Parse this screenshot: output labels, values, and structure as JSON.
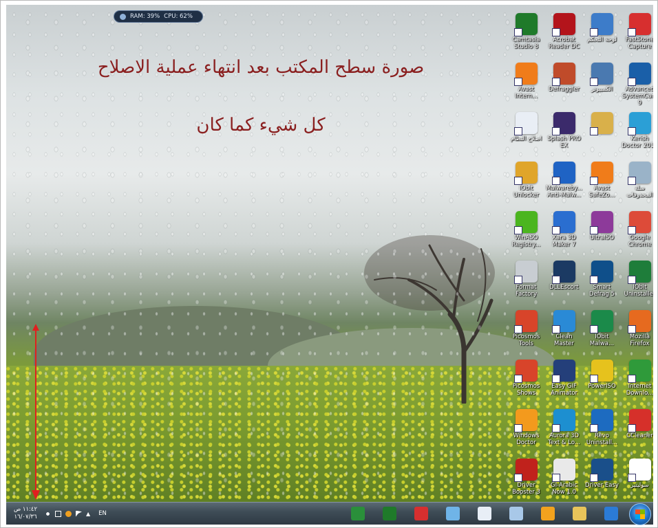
{
  "overlay": {
    "line1": "صورة سطح المكتب بعد انتهاء عملية الاصلاح",
    "line2": "كل شيء كما كان"
  },
  "gauge": {
    "ram": "RAM: 39%",
    "cpu": "CPU: 62%"
  },
  "desktop_icons": [
    {
      "label": "Camtasia Studio 8",
      "icon": "camtasia-icon",
      "color": "#1f7a2a"
    },
    {
      "label": "Acrobat Reader DC",
      "icon": "acrobat-icon",
      "color": "#b3141b"
    },
    {
      "label": "لوحة التحكم",
      "icon": "control-panel-icon",
      "color": "#3d7cc9"
    },
    {
      "label": "FastStone Capture",
      "icon": "faststone-icon",
      "color": "#d72f2f"
    },
    {
      "label": "Avast Intern...",
      "icon": "avast-icon",
      "color": "#f07c1a"
    },
    {
      "label": "Defraggler",
      "icon": "defraggler-icon",
      "color": "#c04b2a"
    },
    {
      "label": "الكمبيوتر",
      "icon": "computer-icon",
      "color": "#4a79b0"
    },
    {
      "label": "Advanced SystemCare 9",
      "icon": "systemcare-icon",
      "color": "#1a5fa8"
    },
    {
      "label": "اصلاح النظام",
      "icon": "document-icon",
      "color": "#e9eef5"
    },
    {
      "label": "Splash PRO EX",
      "icon": "splash-icon",
      "color": "#3b2a6b"
    },
    {
      "label": "",
      "icon": "user-folder-icon",
      "color": "#d9b04a"
    },
    {
      "label": "Kerish Doctor 2016",
      "icon": "kerish-icon",
      "color": "#2b9fd6"
    },
    {
      "label": "IObit Unlocker",
      "icon": "unlocker-icon",
      "color": "#e0a52a"
    },
    {
      "label": "Malwareby... Anti-Malw...",
      "icon": "malwarebytes-icon",
      "color": "#1f63c4"
    },
    {
      "label": "Avast SafeZo...",
      "icon": "safezone-icon",
      "color": "#f07c1a"
    },
    {
      "label": "سلة المحذوفات",
      "icon": "recycle-bin-icon",
      "color": "#9ab3c8"
    },
    {
      "label": "WinASO Registry...",
      "icon": "winaso-icon",
      "color": "#4bb51f"
    },
    {
      "label": "Xara 3D Maker 7",
      "icon": "xara-icon",
      "color": "#2a6ed0"
    },
    {
      "label": "UltraISO",
      "icon": "ultraiso-icon",
      "color": "#8d3a9a"
    },
    {
      "label": "Google Chrome",
      "icon": "chrome-icon",
      "color": "#dd4b39"
    },
    {
      "label": "Format Factory",
      "icon": "format-factory-icon",
      "color": "#c8cdd2"
    },
    {
      "label": "DLLEscort",
      "icon": "dllescort-icon",
      "color": "#1b3a63"
    },
    {
      "label": "Smart Defrag 5",
      "icon": "smart-defrag-icon",
      "color": "#0f4f8a"
    },
    {
      "label": "IObit Uninstaller",
      "icon": "iobit-uninstaller-icon",
      "color": "#1e7d3a"
    },
    {
      "label": "Picosmos Tools",
      "icon": "picosmos-tools-icon",
      "color": "#d8442a"
    },
    {
      "label": "Clean Master",
      "icon": "clean-master-icon",
      "color": "#2a8ad6"
    },
    {
      "label": "IObit Malwa...",
      "icon": "iobit-malware-icon",
      "color": "#1b8a4a"
    },
    {
      "label": "Mozilla Firefox",
      "icon": "firefox-icon",
      "color": "#e66a1f"
    },
    {
      "label": "Picosmos Shows",
      "icon": "picosmos-shows-icon",
      "color": "#d8442a"
    },
    {
      "label": "Easy GIF Animator",
      "icon": "gif-animator-icon",
      "color": "#243f7a"
    },
    {
      "label": "PowerISO",
      "icon": "poweriso-icon",
      "color": "#e6c21d"
    },
    {
      "label": "Internet Downlo...",
      "icon": "idm-icon",
      "color": "#2f9a3a"
    },
    {
      "label": "Windows Doctor",
      "icon": "windows-doctor-icon",
      "color": "#f39a1d"
    },
    {
      "label": "Aurora 3D Text & Lo...",
      "icon": "aurora-icon",
      "color": "#1d8fd0"
    },
    {
      "label": "Revo Uninstall...",
      "icon": "revo-icon",
      "color": "#1d6bc0"
    },
    {
      "label": "CCleaner",
      "icon": "ccleaner-icon",
      "color": "#d6302a"
    },
    {
      "label": "Driver Booster 3",
      "icon": "driver-booster-icon",
      "color": "#c0221c"
    },
    {
      "label": "GI-Arabic Now 1.0",
      "icon": "gi-arabic-icon",
      "color": "#e9e9e9"
    },
    {
      "label": "Driver Easy",
      "icon": "driver-easy-icon",
      "color": "#1a4f8a"
    },
    {
      "label": "سوليتير",
      "icon": "solitaire-icon",
      "color": "#ffffff"
    }
  ],
  "taskbar": {
    "time": "١١:٤٢ ص",
    "date": "١٦/٠٧/٣٦",
    "lang": "EN",
    "pinned": [
      {
        "icon": "camtasia-recorder-icon",
        "color": "#2a8f3a"
      },
      {
        "icon": "camtasia-studio-icon",
        "color": "#1f7a2a"
      },
      {
        "icon": "faststone-taskbar-icon",
        "color": "#d72f2f"
      },
      {
        "icon": "paint-icon",
        "color": "#6fb4e8"
      },
      {
        "icon": "wordpad-icon",
        "color": "#e8eef6"
      },
      {
        "icon": "paint-net-icon",
        "color": "#a8c8e8"
      },
      {
        "icon": "media-player-icon",
        "color": "#f2a21e"
      },
      {
        "icon": "explorer-icon",
        "color": "#e8c45a"
      },
      {
        "icon": "ie-icon",
        "color": "#2b7bd6"
      }
    ]
  }
}
